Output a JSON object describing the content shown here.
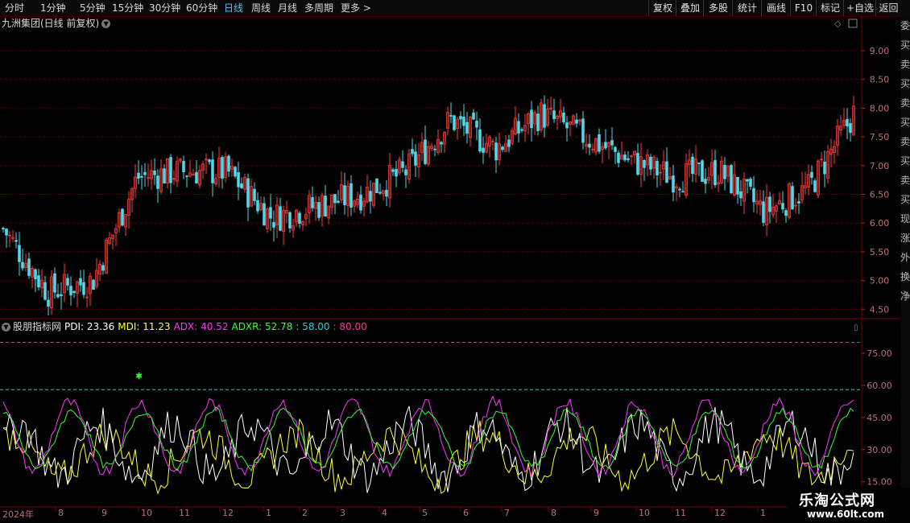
{
  "toolbar": {
    "periods": [
      "分时",
      "1分钟",
      "5分钟",
      "15分钟",
      "30分钟",
      "60分钟",
      "日线",
      "周线",
      "月线",
      "多周期",
      "更多 >"
    ],
    "active_period": "日线",
    "buttons": [
      "复权",
      "叠加",
      "多股",
      "统计",
      "画线",
      "F10",
      "标记",
      "+自选",
      "返回"
    ]
  },
  "main_chart": {
    "title": "九洲集团(日线 前复权)",
    "y_ticks": [
      "9.00",
      "8.50",
      "8.00",
      "7.50",
      "7.00",
      "6.50",
      "6.00",
      "5.50",
      "5.00",
      "4.50"
    ],
    "y_range": [
      4.35,
      9.35
    ],
    "up_color": "#ff3b3b",
    "down_color": "#4fd8e8"
  },
  "indicator": {
    "name": "股朋指标网",
    "pdi_label": "PDI: 23.36",
    "mdi_label": "MDI: 11.23",
    "adx_label": "ADX: 40.52",
    "adxr_label": "ADXR: 52.78",
    "level1_label": ": 58.00",
    "level2_label": ": 80.00",
    "y_ticks": [
      "75.00",
      "60.00",
      "45.00",
      "30.00",
      "15.00"
    ],
    "y_range": [
      4,
      84
    ],
    "colors": {
      "pdi": "#ffffff",
      "mdi": "#ffff33",
      "adx": "#ff33ff",
      "adxr": "#33ff33",
      "level1": "#33cccc",
      "level2": "#ff3399"
    }
  },
  "x_axis": {
    "labels": [
      "2024年",
      "8",
      "9",
      "10",
      "11",
      "12",
      "1",
      "2",
      "3",
      "4",
      "5",
      "6",
      "7",
      "8",
      "9",
      "10",
      "11",
      "12",
      "1"
    ]
  },
  "chart_data": [
    {
      "type": "candlestick",
      "title": "九洲集团(日线 前复权)",
      "ylim": [
        4.35,
        9.35
      ],
      "approx_close_path": [
        {
          "x": "2024年",
          "y": 5.9
        },
        {
          "x": "8",
          "y": 4.8
        },
        {
          "x": "9",
          "y": 5.0
        },
        {
          "x": "10",
          "y": 6.8
        },
        {
          "x": "11",
          "y": 6.9
        },
        {
          "x": "12",
          "y": 6.9
        },
        {
          "x": "1",
          "y": 6.1
        },
        {
          "x": "2",
          "y": 6.3
        },
        {
          "x": "3",
          "y": 6.5
        },
        {
          "x": "4",
          "y": 6.9
        },
        {
          "x": "5",
          "y": 7.8
        },
        {
          "x": "6",
          "y": 7.3
        },
        {
          "x": "7",
          "y": 7.9
        },
        {
          "x": "8",
          "y": 7.5
        },
        {
          "x": "9",
          "y": 7.1
        },
        {
          "x": "10",
          "y": 6.8
        },
        {
          "x": "11",
          "y": 6.9
        },
        {
          "x": "12",
          "y": 6.2
        },
        {
          "x": "1",
          "y": 6.6
        },
        {
          "x": "end",
          "y": 7.9
        }
      ]
    },
    {
      "type": "line",
      "title": "股朋指标网",
      "ylim": [
        4,
        84
      ],
      "series": [
        {
          "name": "PDI",
          "color": "#ffffff",
          "last": 23.36
        },
        {
          "name": "MDI",
          "color": "#ffff33",
          "last": 11.23
        },
        {
          "name": "ADX",
          "color": "#ff33ff",
          "last": 40.52
        },
        {
          "name": "ADXR",
          "color": "#33ff33",
          "last": 52.78
        }
      ],
      "levels": [
        58.0,
        80.0
      ]
    }
  ],
  "watermark": {
    "line1": "乐淘公式网",
    "line2": "www.60lt.com"
  },
  "sidebar_chars": [
    "委",
    "买",
    "卖",
    "买",
    "卖",
    "买",
    "卖",
    "买",
    "卖",
    "买",
    "现",
    "涨",
    "外",
    "换",
    "净"
  ]
}
